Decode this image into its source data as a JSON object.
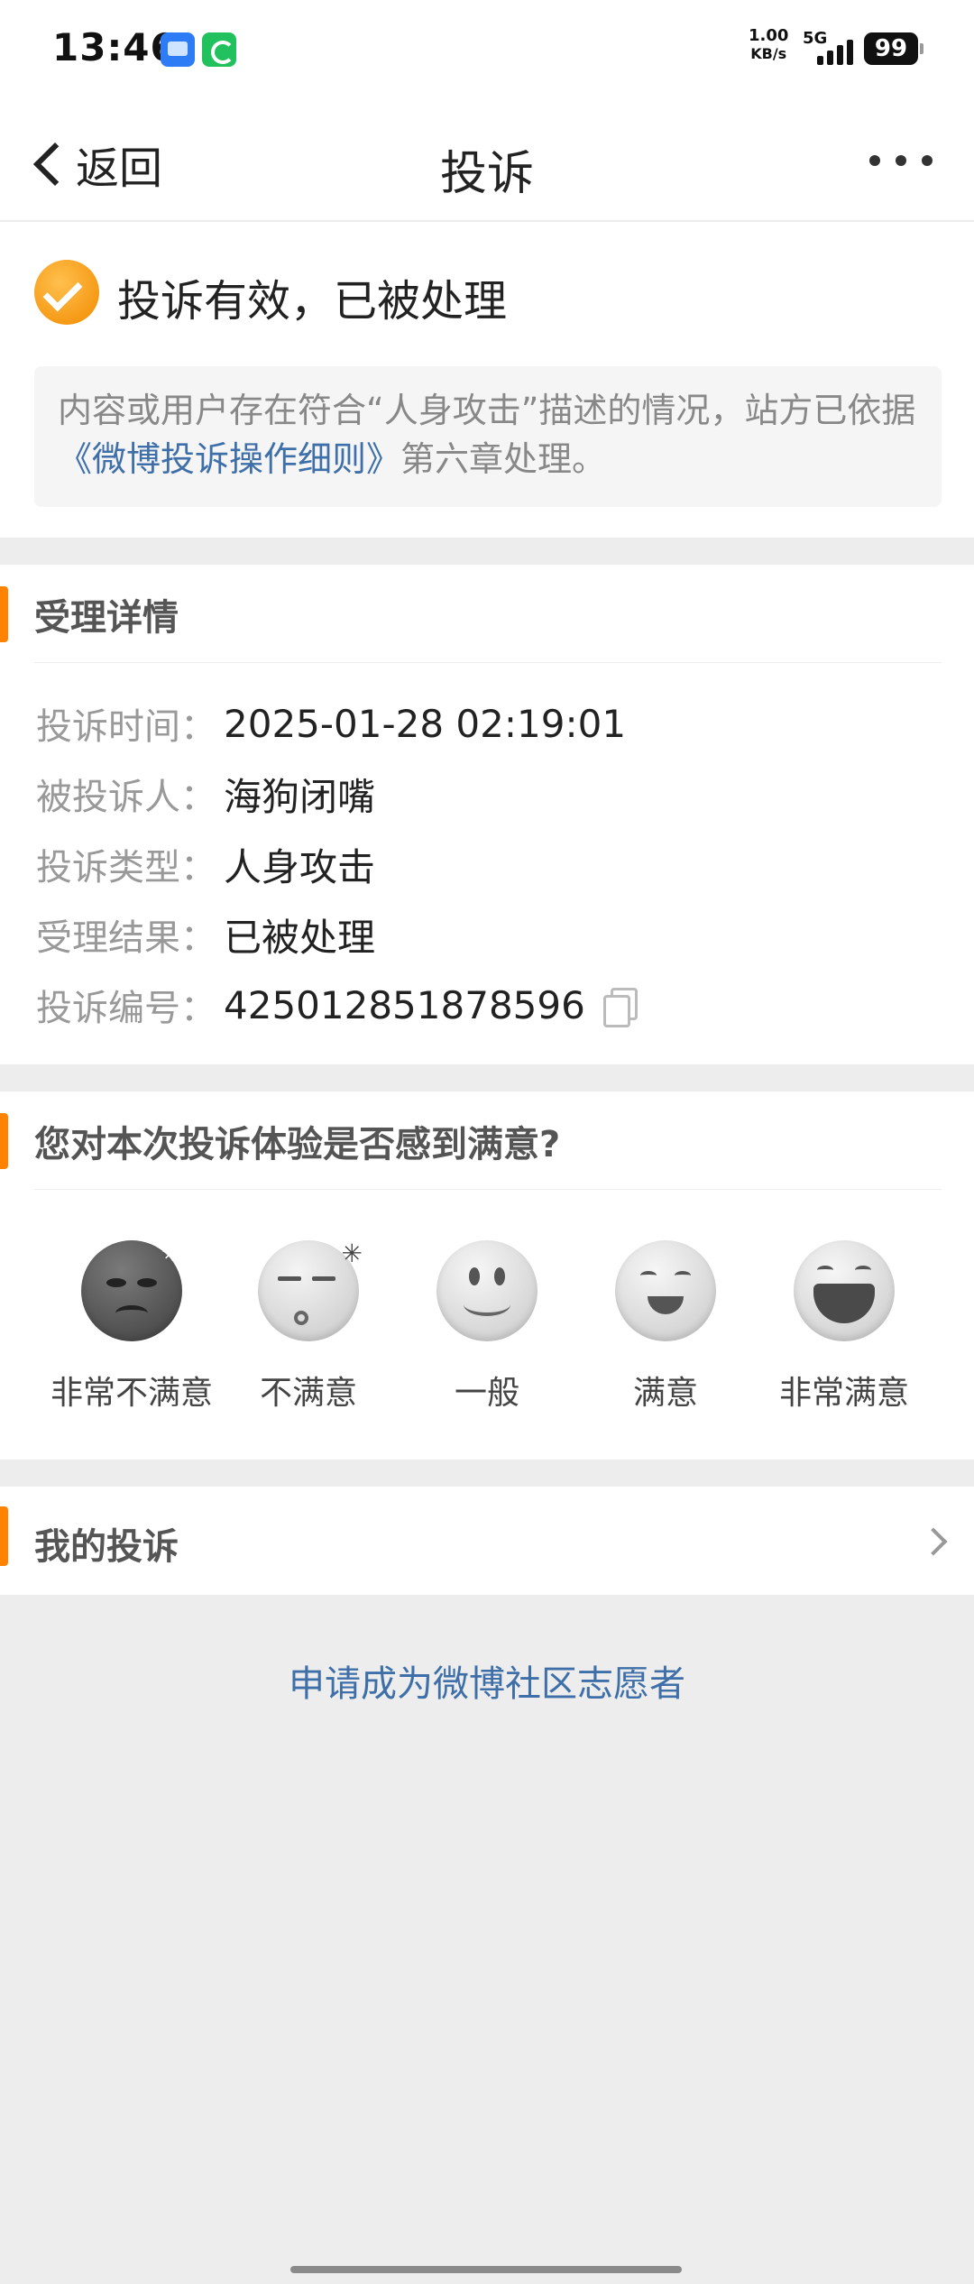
{
  "status_bar": {
    "time": "13:46",
    "net_speed_value": "1.00",
    "net_speed_unit": "KB/s",
    "network": "5G",
    "battery": "99"
  },
  "nav": {
    "back_label": "返回",
    "title": "投诉",
    "more_icon": "more-dots-icon"
  },
  "result": {
    "icon": "check-circle-icon",
    "title": "投诉有效，已被处理",
    "desc_prefix": "内容或用户存在符合“人身攻击”描述的情况，站方已依据",
    "rule_link": "《微博投诉操作细则》",
    "desc_suffix": "第六章处理。"
  },
  "detail": {
    "section_title": "受理详情",
    "rows": [
      {
        "label": "投诉时间：",
        "value": "2025-01-28 02:19:01"
      },
      {
        "label": "被投诉人：",
        "value": "海狗闭嘴"
      },
      {
        "label": "投诉类型：",
        "value": "人身攻击"
      },
      {
        "label": "受理结果：",
        "value": "已被处理"
      },
      {
        "label": "投诉编号：",
        "value": "425012851878596"
      }
    ]
  },
  "rating": {
    "question": "您对本次投诉体验是否感到满意?",
    "options": [
      {
        "label": "非常不满意",
        "icon": "very-dissatisfied-face-icon"
      },
      {
        "label": "不满意",
        "icon": "dissatisfied-face-icon"
      },
      {
        "label": "一般",
        "icon": "neutral-face-icon"
      },
      {
        "label": "满意",
        "icon": "satisfied-face-icon"
      },
      {
        "label": "非常满意",
        "icon": "very-satisfied-face-icon"
      }
    ]
  },
  "my_complaints": {
    "title": "我的投诉"
  },
  "volunteer_link": "申请成为微博社区志愿者",
  "colors": {
    "accent": "#ff8200",
    "link": "#3e6fa8",
    "background": "#ededed"
  }
}
